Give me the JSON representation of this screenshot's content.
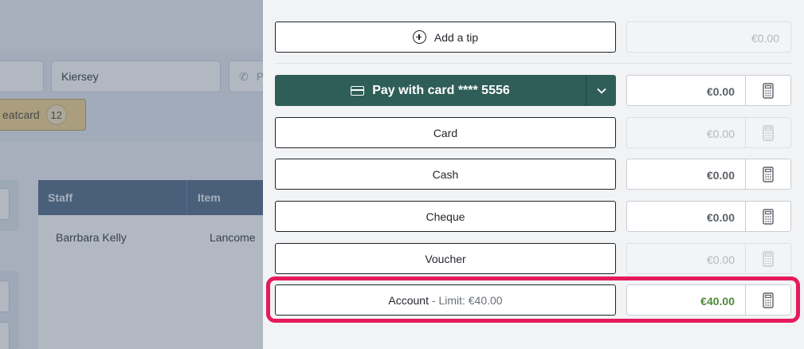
{
  "background": {
    "last_name_value": "Kiersey",
    "phone_placeholder_partial": "P",
    "giftcard_chip_label": "eatcard",
    "giftcard_count": "12",
    "table_headers": [
      "Staff",
      "Item"
    ],
    "row": {
      "staff": "Barrbara Kelly",
      "item": "Lancome"
    }
  },
  "tip": {
    "label": "Add a tip",
    "amount": "€0.00"
  },
  "card_on_file": {
    "label": "Pay with card **** 5556",
    "amount": "€0.00"
  },
  "methods": [
    {
      "label": "Card",
      "amount": "€0.00",
      "enabled": false
    },
    {
      "label": "Cash",
      "amount": "€0.00",
      "enabled": true
    },
    {
      "label": "Cheque",
      "amount": "€0.00",
      "enabled": true
    },
    {
      "label": "Voucher",
      "amount": "€0.00",
      "enabled": false
    }
  ],
  "account": {
    "label": "Account",
    "separator": " - ",
    "limit": "Limit: €40.00",
    "amount": "€40.00"
  },
  "colors": {
    "primary": "#2e5e57",
    "highlight": "#e61a5b",
    "positive": "#4e8a3a"
  }
}
